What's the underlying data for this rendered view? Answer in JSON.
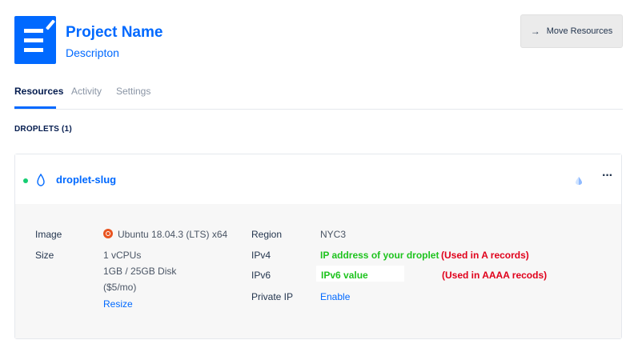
{
  "header": {
    "title": "Project Name",
    "description": "Descripton",
    "move_button": "Move Resources",
    "move_arrow": "→"
  },
  "tabs": [
    {
      "label": "Resources",
      "active": true
    },
    {
      "label": "Activity",
      "active": false
    },
    {
      "label": "Settings",
      "active": false
    }
  ],
  "section": {
    "label": "DROPLETS (1)"
  },
  "droplet": {
    "name": "droplet-slug",
    "status_color": "#15cd72",
    "more": "···",
    "details": {
      "image_label": "Image",
      "image_value": "Ubuntu 18.04.3 (LTS) x64",
      "size_label": "Size",
      "size_lines": [
        "1 vCPUs",
        "1GB / 25GB Disk",
        "($5/mo)"
      ],
      "resize_link": "Resize",
      "region_label": "Region",
      "region_value": "NYC3",
      "ipv4_label": "IPv4",
      "ipv4_value": "IP address of your droplet",
      "ipv4_note": "(Used in A records)",
      "ipv6_label": "IPv6",
      "ipv6_value": "IPv6 value",
      "ipv6_note": "(Used in AAAA recods)",
      "private_ip_label": "Private IP",
      "private_ip_link": "Enable"
    }
  },
  "colors": {
    "brand_blue": "#0069ff",
    "green_text": "#1ec31e",
    "red_text": "#e0001b"
  }
}
